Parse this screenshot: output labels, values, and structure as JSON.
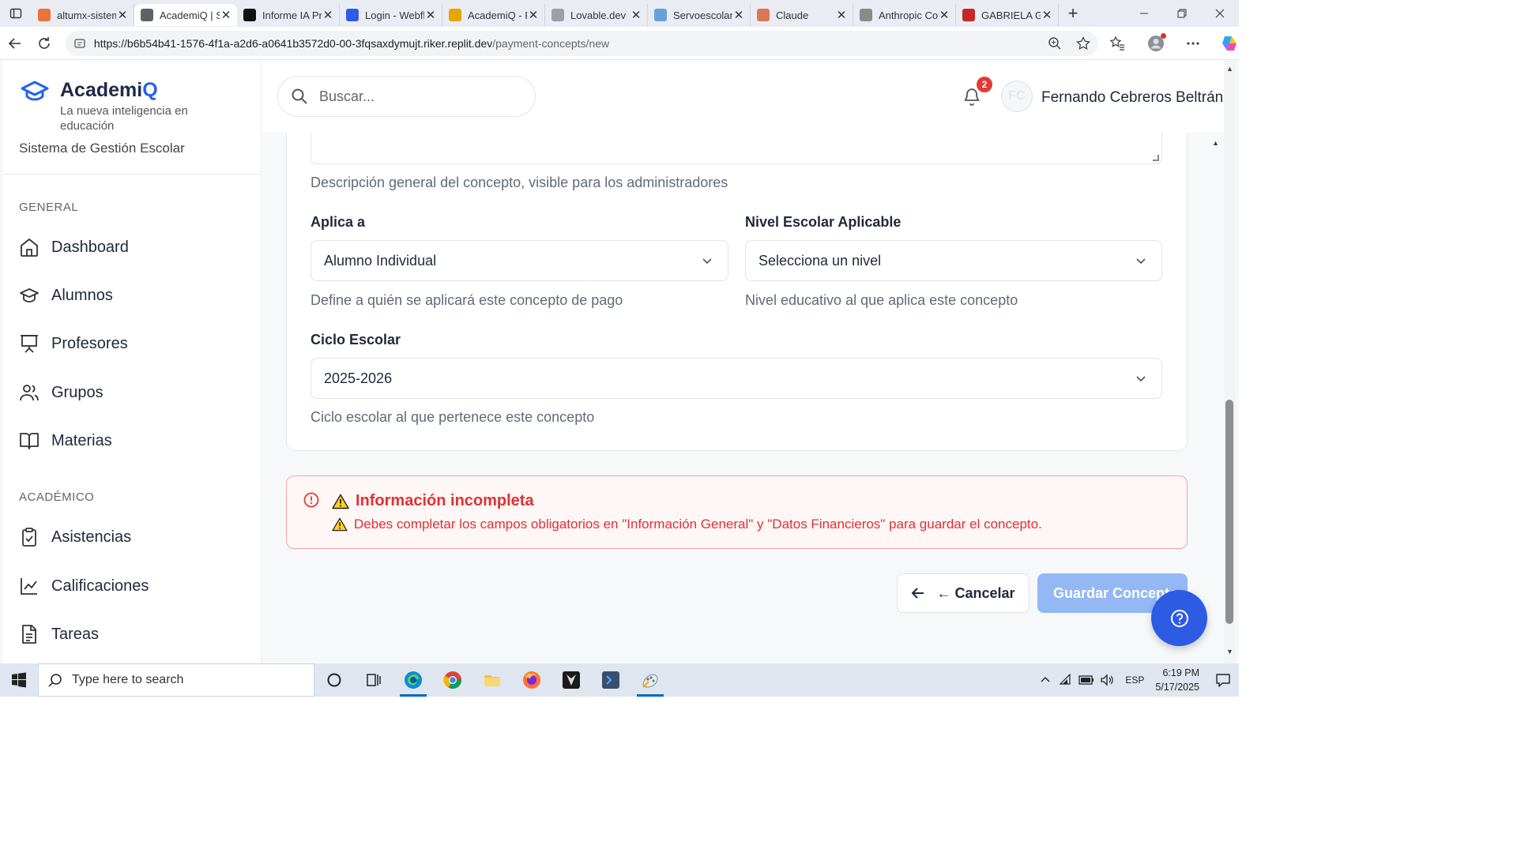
{
  "browser": {
    "tabs": [
      {
        "title": "altumx-sistema",
        "color": "#e8743b"
      },
      {
        "title": "AcademiQ | S",
        "color": "#5f6368"
      },
      {
        "title": "Informe IA Pro",
        "color": "#111111"
      },
      {
        "title": "Login - Webflow",
        "color": "#2f5bea"
      },
      {
        "title": "AcademiQ - Re",
        "color": "#e8a400"
      },
      {
        "title": "Lovable.dev",
        "color": "#9aa0a6"
      },
      {
        "title": "Servoescolar",
        "color": "#6aa0d8"
      },
      {
        "title": "Claude",
        "color": "#d97757"
      },
      {
        "title": "Anthropic Cons",
        "color": "#8a8a8a"
      },
      {
        "title": "GABRIELA G",
        "color": "#c62828"
      }
    ],
    "active_tab_index": 1,
    "url_host": "https://b6b54b41-1576-4f1a-a2d6-a0641b3572d0-00-3fqsaxdymujt.riker.replit.dev",
    "url_path": "/payment-concepts/new"
  },
  "sidebar": {
    "brand_name_main": "Academi",
    "brand_name_accent": "Q",
    "tagline": "La nueva inteligencia en educación",
    "system_label": "Sistema de Gestión Escolar",
    "section_general": "GENERAL",
    "section_academic": "ACADÉMICO",
    "items": [
      {
        "label": "Dashboard",
        "icon": "home-icon"
      },
      {
        "label": "Alumnos",
        "icon": "graduation-cap-icon"
      },
      {
        "label": "Profesores",
        "icon": "presentation-icon"
      },
      {
        "label": "Grupos",
        "icon": "users-icon"
      },
      {
        "label": "Materias",
        "icon": "book-open-icon"
      },
      {
        "label": "Asistencias",
        "icon": "clipboard-check-icon"
      },
      {
        "label": "Calificaciones",
        "icon": "line-chart-icon"
      },
      {
        "label": "Tareas",
        "icon": "file-text-icon"
      }
    ]
  },
  "header": {
    "search_placeholder": "Buscar...",
    "notification_count": "2",
    "avatar_initials": "FC",
    "user_name": "Fernando Cebreros Beltrán"
  },
  "form": {
    "description_help": "Descripción general del concepto, visible para los administradores",
    "applies_to_label": "Aplica a",
    "applies_to_value": "Alumno Individual",
    "applies_to_help": "Define a quién se aplicará este concepto de pago",
    "level_label": "Nivel Escolar Aplicable",
    "level_value": "Selecciona un nivel",
    "level_help": "Nivel educativo al que aplica este concepto",
    "cycle_label": "Ciclo Escolar",
    "cycle_value": "2025-2026",
    "cycle_help": "Ciclo escolar al que pertenece este concepto"
  },
  "alert": {
    "title": "Información incompleta",
    "message": "Debes completar los campos obligatorios en \"Información General\" y \"Datos Financieros\" para guardar el concepto.",
    "color": "#e03131"
  },
  "actions": {
    "cancel_label": "← Cancelar",
    "save_label": "Guardar Concepto"
  },
  "taskbar": {
    "search_placeholder": "Type here to search",
    "language": "ESP",
    "time": "6:19 PM",
    "date": "5/17/2025"
  }
}
